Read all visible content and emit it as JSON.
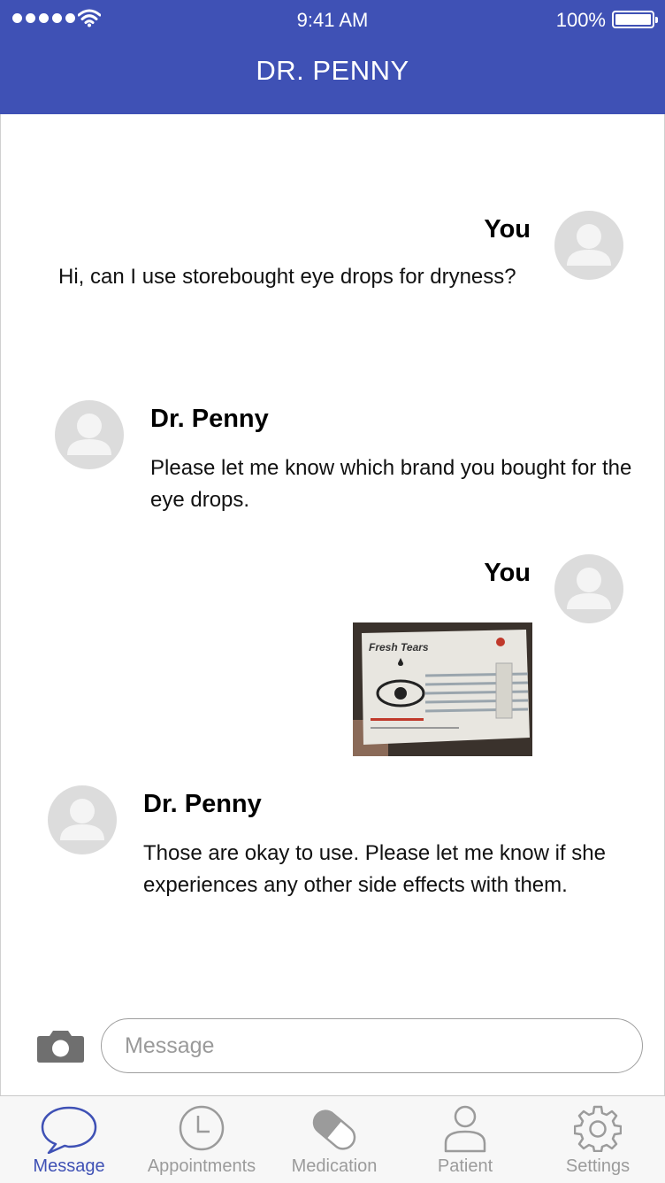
{
  "status_bar": {
    "time": "9:41 AM",
    "battery": "100%"
  },
  "header": {
    "title": "DR. PENNY"
  },
  "messages": [
    {
      "sender": "You",
      "text": "Hi, can I use storebought eye drops for dryness?"
    },
    {
      "sender": "Dr. Penny",
      "text": "Please let me know which brand you bought for the eye drops."
    },
    {
      "sender": "You",
      "image_text": "Fresh Tears"
    },
    {
      "sender": "Dr. Penny",
      "text": "Those are okay to use. Please let me know if she experiences any other side effects with them."
    }
  ],
  "composer": {
    "placeholder": "Message",
    "value": ""
  },
  "tabs": [
    {
      "label": "Message",
      "icon": "chat-bubble-icon",
      "active": true
    },
    {
      "label": "Appointments",
      "icon": "clock-icon",
      "active": false
    },
    {
      "label": "Medication",
      "icon": "pill-icon",
      "active": false
    },
    {
      "label": "Patient",
      "icon": "person-icon",
      "active": false
    },
    {
      "label": "Settings",
      "icon": "gear-icon",
      "active": false
    }
  ],
  "colors": {
    "brand": "#3f51b5",
    "tab_inactive": "#9b9b9b",
    "avatar_bg": "#dcdcdc"
  }
}
